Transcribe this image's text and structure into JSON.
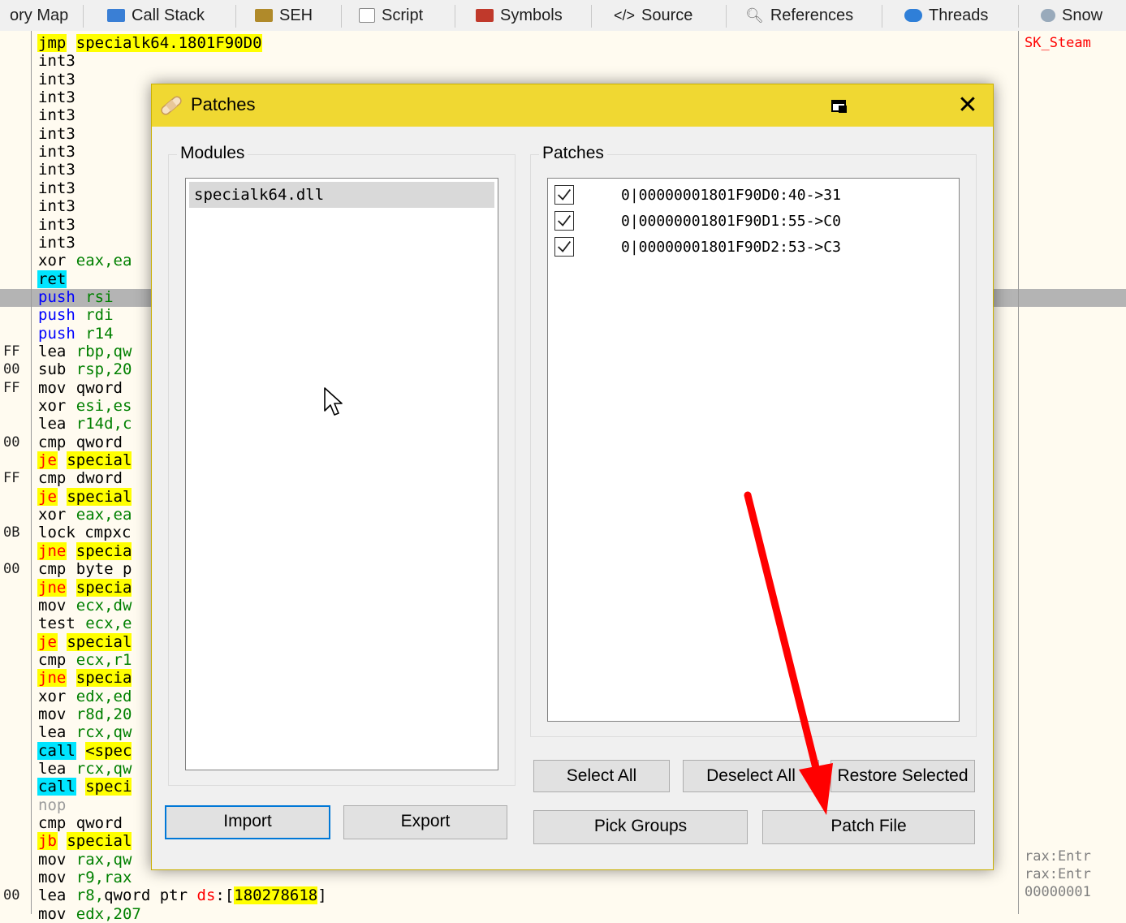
{
  "tabs": [
    {
      "label": "ory Map",
      "icon": "memory-map-icon"
    },
    {
      "label": "Call Stack",
      "icon": "call-stack-icon"
    },
    {
      "label": "SEH",
      "icon": "seh-icon"
    },
    {
      "label": "Script",
      "icon": "script-icon"
    },
    {
      "label": "Symbols",
      "icon": "symbols-icon"
    },
    {
      "label": "Source",
      "icon": "source-icon"
    },
    {
      "label": "References",
      "icon": "references-icon"
    },
    {
      "label": "Threads",
      "icon": "threads-icon"
    },
    {
      "label": "Snow",
      "icon": "snowman-icon"
    }
  ],
  "disassembly": {
    "lines": [
      {
        "addr": "",
        "mnem": "jmp",
        "kind": "jmp",
        "ops": [
          {
            "t": "specialk64.1801F90D0",
            "s": "hl"
          }
        ]
      },
      {
        "addr": "",
        "mnem": "int3",
        "kind": "int3",
        "ops": []
      },
      {
        "addr": "",
        "mnem": "int3",
        "kind": "int3",
        "ops": []
      },
      {
        "addr": "",
        "mnem": "int3",
        "kind": "int3",
        "ops": []
      },
      {
        "addr": "",
        "mnem": "int3",
        "kind": "int3",
        "ops": []
      },
      {
        "addr": "",
        "mnem": "int3",
        "kind": "int3",
        "ops": []
      },
      {
        "addr": "",
        "mnem": "int3",
        "kind": "int3",
        "ops": []
      },
      {
        "addr": "",
        "mnem": "int3",
        "kind": "int3",
        "ops": []
      },
      {
        "addr": "",
        "mnem": "int3",
        "kind": "int3",
        "ops": []
      },
      {
        "addr": "",
        "mnem": "int3",
        "kind": "int3",
        "ops": []
      },
      {
        "addr": "",
        "mnem": "int3",
        "kind": "int3",
        "ops": []
      },
      {
        "addr": "",
        "mnem": "int3",
        "kind": "int3",
        "ops": []
      },
      {
        "addr": "",
        "mnem": "xor",
        "kind": "norm",
        "ops": [
          {
            "t": "eax,ea",
            "s": "g"
          }
        ]
      },
      {
        "addr": "",
        "mnem": "ret",
        "kind": "ret",
        "ops": []
      },
      {
        "addr": "",
        "mnem": "push",
        "kind": "push",
        "ops": [
          {
            "t": "rsi",
            "s": "g"
          }
        ]
      },
      {
        "addr": "",
        "mnem": "push",
        "kind": "push",
        "ops": [
          {
            "t": "rdi",
            "s": "g"
          }
        ]
      },
      {
        "addr": "",
        "mnem": "push",
        "kind": "push",
        "ops": [
          {
            "t": "r14",
            "s": "g"
          }
        ]
      },
      {
        "addr": "FF",
        "mnem": "lea",
        "kind": "norm",
        "ops": [
          {
            "t": "rbp,qw",
            "s": "g"
          }
        ]
      },
      {
        "addr": "00",
        "mnem": "sub",
        "kind": "norm",
        "ops": [
          {
            "t": "rsp,20",
            "s": "g"
          }
        ]
      },
      {
        "addr": "FF",
        "mnem": "mov",
        "kind": "norm",
        "ops": [
          {
            "t": "qword",
            "s": "k"
          }
        ]
      },
      {
        "addr": "",
        "mnem": "xor",
        "kind": "norm",
        "ops": [
          {
            "t": "esi,es",
            "s": "g"
          }
        ]
      },
      {
        "addr": "",
        "mnem": "lea",
        "kind": "norm",
        "ops": [
          {
            "t": "r14d,c",
            "s": "g"
          }
        ]
      },
      {
        "addr": "00",
        "mnem": "cmp",
        "kind": "norm",
        "ops": [
          {
            "t": "qword",
            "s": "k"
          }
        ]
      },
      {
        "addr": "",
        "mnem": "je",
        "kind": "jcc",
        "ops": [
          {
            "t": "special",
            "s": "hl"
          }
        ]
      },
      {
        "addr": "FF",
        "mnem": "cmp",
        "kind": "norm",
        "ops": [
          {
            "t": "dword",
            "s": "k"
          }
        ]
      },
      {
        "addr": "",
        "mnem": "je",
        "kind": "jcc",
        "ops": [
          {
            "t": "special",
            "s": "hl"
          }
        ]
      },
      {
        "addr": "",
        "mnem": "xor",
        "kind": "norm",
        "ops": [
          {
            "t": "eax,ea",
            "s": "g"
          }
        ]
      },
      {
        "addr": "0B",
        "mnem": "lock cmpxc",
        "kind": "norm",
        "ops": []
      },
      {
        "addr": "",
        "mnem": "jne",
        "kind": "jcc",
        "ops": [
          {
            "t": "specia",
            "s": "hl"
          }
        ]
      },
      {
        "addr": "00",
        "mnem": "cmp",
        "kind": "norm",
        "ops": [
          {
            "t": "byte p",
            "s": "k"
          }
        ]
      },
      {
        "addr": "",
        "mnem": "jne",
        "kind": "jcc",
        "ops": [
          {
            "t": "specia",
            "s": "hl"
          }
        ]
      },
      {
        "addr": "",
        "mnem": "mov",
        "kind": "norm",
        "ops": [
          {
            "t": "ecx,dw",
            "s": "g"
          }
        ]
      },
      {
        "addr": "",
        "mnem": "test",
        "kind": "norm",
        "ops": [
          {
            "t": "ecx,e",
            "s": "g"
          }
        ]
      },
      {
        "addr": "",
        "mnem": "je",
        "kind": "jcc",
        "ops": [
          {
            "t": "special",
            "s": "hl"
          }
        ]
      },
      {
        "addr": "",
        "mnem": "cmp",
        "kind": "norm",
        "ops": [
          {
            "t": "ecx,r1",
            "s": "g"
          }
        ]
      },
      {
        "addr": "",
        "mnem": "jne",
        "kind": "jcc",
        "ops": [
          {
            "t": "specia",
            "s": "hl"
          }
        ]
      },
      {
        "addr": "",
        "mnem": "xor",
        "kind": "norm",
        "ops": [
          {
            "t": "edx,ed",
            "s": "g"
          }
        ]
      },
      {
        "addr": "",
        "mnem": "mov",
        "kind": "norm",
        "ops": [
          {
            "t": "r8d,20",
            "s": "g"
          }
        ]
      },
      {
        "addr": "",
        "mnem": "lea",
        "kind": "norm",
        "ops": [
          {
            "t": "rcx,qw",
            "s": "g"
          }
        ]
      },
      {
        "addr": "",
        "mnem": "call",
        "kind": "call",
        "ops": [
          {
            "t": "<spec",
            "s": "hl"
          }
        ]
      },
      {
        "addr": "",
        "mnem": "lea",
        "kind": "norm",
        "ops": [
          {
            "t": "rcx,qw",
            "s": "g"
          }
        ]
      },
      {
        "addr": "",
        "mnem": "call",
        "kind": "call",
        "ops": [
          {
            "t": "speci",
            "s": "hl"
          }
        ]
      },
      {
        "addr": "",
        "mnem": "nop",
        "kind": "nop",
        "ops": []
      },
      {
        "addr": "",
        "mnem": "cmp",
        "kind": "norm",
        "ops": [
          {
            "t": "qword",
            "s": "k"
          }
        ]
      },
      {
        "addr": "",
        "mnem": "jb",
        "kind": "jcc",
        "ops": [
          {
            "t": "special",
            "s": "hl"
          }
        ]
      },
      {
        "addr": "",
        "mnem": "mov",
        "kind": "norm",
        "ops": [
          {
            "t": "rax,qw",
            "s": "g"
          }
        ]
      },
      {
        "addr": "",
        "mnem": "mov",
        "kind": "norm",
        "ops": [
          {
            "t": "r9,rax",
            "s": "g"
          }
        ]
      },
      {
        "addr": "00",
        "mnem": "lea",
        "kind": "norm",
        "ops": [
          {
            "t": "r8,",
            "s": "g"
          },
          {
            "t": "qword ptr ",
            "s": "k"
          },
          {
            "t": "ds",
            "s": "r"
          },
          {
            "t": ":[",
            "s": "k"
          },
          {
            "t": "180278618",
            "s": "hl"
          },
          {
            "t": "]",
            "s": "k"
          }
        ]
      },
      {
        "addr": "",
        "mnem": "mov",
        "kind": "norm",
        "ops": [
          {
            "t": "edx,207",
            "s": "g"
          }
        ]
      }
    ],
    "right_pane": {
      "top": "SK_Steam",
      "bottom": [
        "rax:Entr",
        "rax:Entr",
        "00000001"
      ]
    }
  },
  "dialog": {
    "title": "Patches",
    "modules_group": "Modules",
    "patches_group": "Patches",
    "modules": [
      "specialk64.dll"
    ],
    "patches": [
      {
        "text": "0|00000001801F90D0:40->31",
        "checked": true
      },
      {
        "text": "0|00000001801F90D1:55->C0",
        "checked": true
      },
      {
        "text": "0|00000001801F90D2:53->C3",
        "checked": true
      }
    ],
    "buttons": {
      "select_all": "Select All",
      "deselect_all": "Deselect All",
      "restore_selected": "Restore Selected",
      "import": "Import",
      "export": "Export",
      "pick_groups": "Pick Groups",
      "patch_file": "Patch File"
    }
  },
  "colors": {
    "title_bar": "#f0d832",
    "annotation_arrow": "#ff0000",
    "jump_highlight": "#ffff00",
    "call_highlight": "#00e5ff"
  }
}
